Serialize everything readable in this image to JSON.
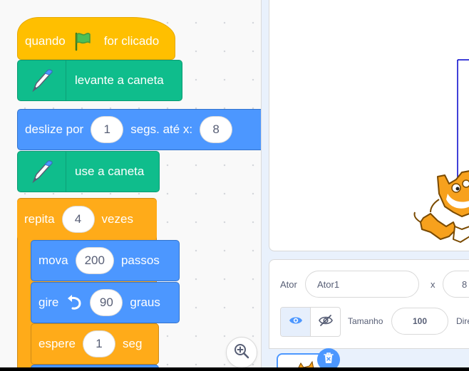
{
  "code_area": {
    "hat_block": {
      "text_before": "quando",
      "icon": "green-flag-icon",
      "text_after": "for clicado"
    },
    "pen_up_block": {
      "icon": "pen-icon",
      "text": "levante a caneta"
    },
    "glide_block": {
      "text_1": "deslize por",
      "secs": "1",
      "text_2": "segs. até x:",
      "x": "8"
    },
    "pen_down_block": {
      "icon": "pen-icon",
      "text": "use a caneta"
    },
    "repeat_block": {
      "text_1": "repita",
      "times": "4",
      "text_2": "vezes"
    },
    "move_block": {
      "text_1": "mova",
      "steps": "200",
      "text_2": "passos"
    },
    "turn_block": {
      "text_1": "gire",
      "icon": "rotate-left-icon",
      "degrees": "90",
      "text_2": "graus"
    },
    "wait_block": {
      "text_1": "espere",
      "secs": "1",
      "text_2": "seg"
    },
    "zoom_button_icon": "zoom-in-icon"
  },
  "sprite_info": {
    "sprite_label": "Ator",
    "sprite_name": "Ator1",
    "x_label": "x",
    "x_value": "8",
    "show_icon": "eye-icon",
    "hide_icon": "eye-slash-icon",
    "size_label": "Tamanho",
    "size_value": "100",
    "direction_label_partial": "Dire"
  },
  "colors": {
    "events": "#ffbf00",
    "pen": "#0fbd8c",
    "motion": "#4c97ff",
    "control": "#ffab19",
    "stage_line": "#0000cc"
  }
}
